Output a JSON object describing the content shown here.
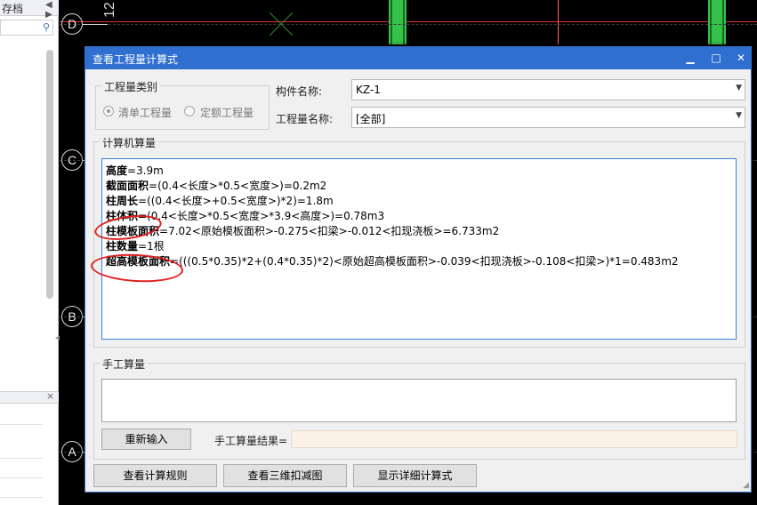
{
  "left_panel": {
    "title": "存档",
    "arrows": "◀ ▶",
    "search_icon": "⚲",
    "bottom_close": "×"
  },
  "cad": {
    "number_label": "12",
    "axes": [
      {
        "label": "D"
      },
      {
        "label": "C"
      },
      {
        "label": "B"
      },
      {
        "label": "A"
      }
    ],
    "colors": {
      "column": "#36c24a",
      "axis_line": "#e03030",
      "background": "#000000"
    }
  },
  "dialog": {
    "title": "查看工程量计算式",
    "controls": {
      "minimize": "▁",
      "maximize": "□",
      "close": "✕"
    },
    "quantity_type": {
      "group_title": "工程量类别",
      "options": [
        {
          "label": "清单工程量",
          "selected": true
        },
        {
          "label": "定额工程量",
          "selected": false
        }
      ]
    },
    "component_name": {
      "label": "构件名称:",
      "value": "KZ-1"
    },
    "quantity_name": {
      "label": "工程量名称:",
      "value": "[全部]"
    },
    "computer_calc": {
      "group_title": "计算机算量",
      "lines": [
        {
          "name": "高度",
          "expr": "=3.9m"
        },
        {
          "name": "截面面积",
          "expr": "=(0.4<长度>*0.5<宽度>)=0.2m2"
        },
        {
          "name": "柱周长",
          "expr": "=((0.4<长度>+0.5<宽度>)*2)=1.8m"
        },
        {
          "name": "柱体积",
          "expr": "=(0.4<长度>*0.5<宽度>*3.9<高度>)=0.78m3"
        },
        {
          "name": "柱模板面积",
          "expr": "=7.02<原始模板面积>-0.275<扣梁>-0.012<扣现浇板>=6.733m2"
        },
        {
          "name": "柱数量",
          "expr": "=1根"
        },
        {
          "name": "超高模板面积",
          "expr": "=(((0.5*0.35)*2+(0.4*0.35)*2)<原始超高模板面积>-0.039<扣现浇板>-0.108<扣梁>)*1=0.483m2"
        }
      ]
    },
    "manual_calc": {
      "group_title": "手工算量",
      "input_value": "",
      "reenter_button": "重新输入",
      "result_label": "手工算量结果=",
      "result_value": ""
    },
    "buttons": {
      "view_rules": "查看计算规则",
      "view_3d": "查看三维扣减图",
      "show_detail": "显示详细计算式"
    },
    "annotation_color": "#e02020"
  }
}
